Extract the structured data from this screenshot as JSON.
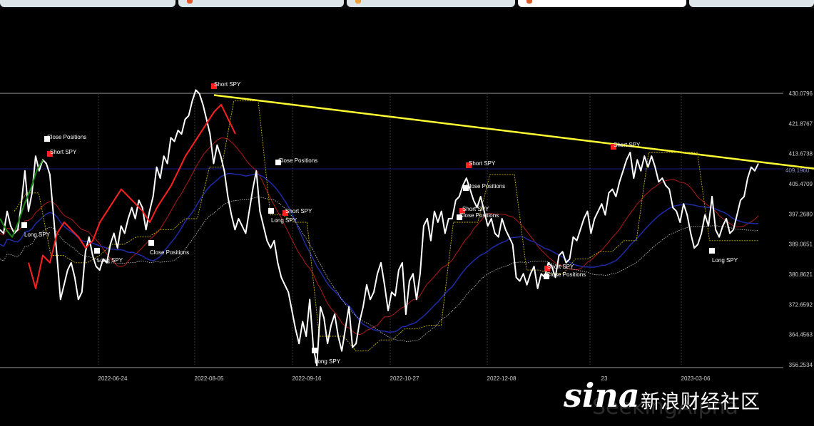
{
  "browser_tabs": [
    {
      "active": false,
      "icon_color": "#888888"
    },
    {
      "active": false,
      "icon_color": "#e05a2a"
    },
    {
      "active": false,
      "icon_color": "#f0a030"
    },
    {
      "active": true,
      "icon_color": "#e05a2a"
    },
    {
      "active": false,
      "icon_color": "#888888"
    }
  ],
  "watermark": {
    "logo": "sina",
    "text": "新浪财经社区",
    "faint_text": "SeekingAlpha"
  },
  "chart_data": {
    "type": "line",
    "x_tick_labels": [
      "2022-06-24",
      "2022-08-05",
      "2022-09-16",
      "2022-10-27",
      "2022-12-08",
      "23",
      "2023-03-06"
    ],
    "y_tick_labels": [
      "430.0796",
      "421.8767",
      "413.6738",
      "405.4709",
      "397.2680",
      "389.0651",
      "380.8621",
      "372.6592",
      "364.4563",
      "356.2534"
    ],
    "ylim": [
      356.2534,
      430.0796
    ],
    "last_price_label": "409.1960",
    "grid": true,
    "series": [
      {
        "color": "#ffffff",
        "values": [
          393,
          392,
          398,
          394,
          392,
          393,
          400,
          409,
          398,
          403,
          413,
          409,
          412,
          411,
          408,
          397,
          386,
          374,
          378,
          382,
          384,
          380,
          374,
          376,
          387,
          391,
          386,
          383,
          382,
          385,
          384,
          389,
          392,
          388,
          394,
          392,
          396,
          399,
          396,
          401,
          399,
          393,
          398,
          402,
          410,
          407,
          413,
          411,
          418,
          417,
          420,
          419,
          423,
          424,
          428,
          431,
          430,
          427,
          423,
          419,
          411,
          416,
          413,
          409,
          402,
          397,
          393,
          396,
          394,
          392,
          398,
          404,
          409,
          398,
          394,
          390,
          388,
          390,
          384,
          380,
          378,
          376,
          371,
          366,
          362,
          368,
          364,
          374,
          361,
          356,
          372,
          369,
          362,
          367,
          370,
          364,
          360,
          366,
          372,
          361,
          362,
          368,
          372,
          378,
          374,
          376,
          381,
          384,
          378,
          371,
          376,
          375,
          382,
          384,
          370,
          379,
          381,
          374,
          381,
          394,
          396,
          390,
          398,
          395,
          398,
          392,
          396,
          396,
          401,
          402,
          405,
          407,
          404,
          401,
          399,
          402,
          398,
          394,
          396,
          392,
          391,
          396,
          393,
          391,
          389,
          380,
          379,
          381,
          378,
          381,
          383,
          377,
          381,
          380,
          384,
          383,
          380,
          386,
          387,
          384,
          385,
          391,
          390,
          393,
          396,
          398,
          392,
          396,
          398,
          400,
          397,
          403,
          404,
          402,
          406,
          409,
          412,
          414,
          407,
          412,
          409,
          413,
          410,
          413,
          410,
          406,
          407,
          405,
          404,
          399,
          398,
          395,
          400,
          397,
          392,
          388,
          389,
          392,
          397,
          394,
          402,
          393,
          391,
          394,
          396,
          392,
          393,
          397,
          401,
          402,
          407,
          410,
          409,
          411
        ]
      },
      {
        "color": "#ff2020",
        "values": [
          384,
          377,
          386,
          384,
          392,
          395,
          393,
          391,
          388,
          390,
          395,
          398,
          401,
          404,
          402,
          400,
          398,
          395,
          399,
          402,
          405,
          409,
          413,
          416,
          419,
          422,
          425,
          427,
          423,
          419,
          415,
          411,
          408,
          404,
          400,
          397,
          394,
          392,
          395,
          398,
          401,
          403,
          400,
          397,
          394,
          390,
          386,
          382,
          378,
          374,
          371,
          368,
          372,
          375,
          378,
          381,
          384,
          387,
          389,
          391,
          393,
          395,
          397,
          399,
          402,
          404,
          401,
          398,
          395,
          392,
          389,
          386,
          383,
          380,
          378,
          381,
          384,
          387,
          390,
          393,
          396,
          399,
          402,
          405,
          408,
          410,
          413,
          411,
          408,
          405,
          402,
          399,
          396,
          393,
          390,
          387,
          385,
          383,
          381,
          384,
          387,
          390,
          393,
          396,
          399,
          402,
          405,
          408,
          411,
          413,
          410,
          408,
          405,
          402,
          400,
          398
        ]
      },
      {
        "color": "#1a7a1a",
        "values": [
          396,
          393,
          391,
          395,
          400,
          404,
          409,
          412
        ]
      }
    ],
    "annotations": [
      "Close Positions",
      "Short SPY",
      "Long SPY",
      "Close Positions",
      "Long SPY",
      "Close Positions",
      "Short SPY",
      "Long SPY",
      "Short SPY",
      "Long SPY",
      "Short SPY",
      "Close Positions",
      "Short SPY",
      "Close Positions",
      "Short SPY",
      "Close Positions",
      "Short SPY",
      "Long SPY"
    ]
  }
}
